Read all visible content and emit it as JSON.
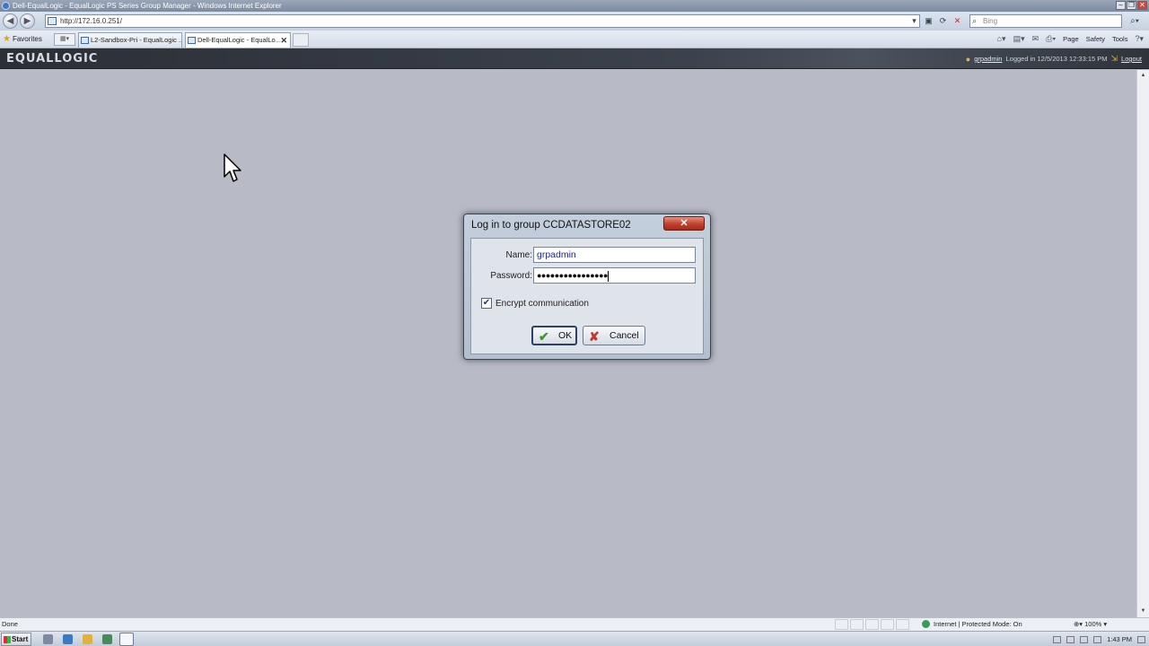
{
  "window": {
    "title": "Dell-EqualLogic - EqualLogic PS Series Group Manager - Windows Internet Explorer"
  },
  "browser": {
    "url": "http://172.16.0.251/",
    "search_placeholder": "Bing",
    "favorites_label": "Favorites",
    "tabs": [
      {
        "label": "L2-Sandbox-Pri - EqualLogic ...",
        "active": false
      },
      {
        "label": "Dell-EqualLogic - EqualLo...",
        "active": true
      }
    ],
    "commands": [
      "Page",
      "Safety",
      "Tools"
    ]
  },
  "app": {
    "logo": "EQUALLOGIC",
    "user": "grpadmin",
    "logged_in": "Logged in 12/5/2013 12:33:15 PM",
    "logout_label": "Logout"
  },
  "dialog": {
    "title": "Log in to group CCDATASTORE02",
    "name_label": "Name:",
    "name_value": "grpadmin",
    "password_label": "Password:",
    "password_value": "●●●●●●●●●●●●●●●●",
    "encrypt_label": "Encrypt communication",
    "encrypt_checked": true,
    "ok_label": "OK",
    "cancel_label": "Cancel"
  },
  "status": {
    "text": "Done",
    "zone": "Internet | Protected Mode: On",
    "zoom": "100%"
  },
  "taskbar": {
    "start_label": "Start",
    "clock": "1:43 PM"
  },
  "colors": {
    "content_bg": "#b8bbc6",
    "header_bg": "#2f343b",
    "close_red": "#c2402d"
  }
}
